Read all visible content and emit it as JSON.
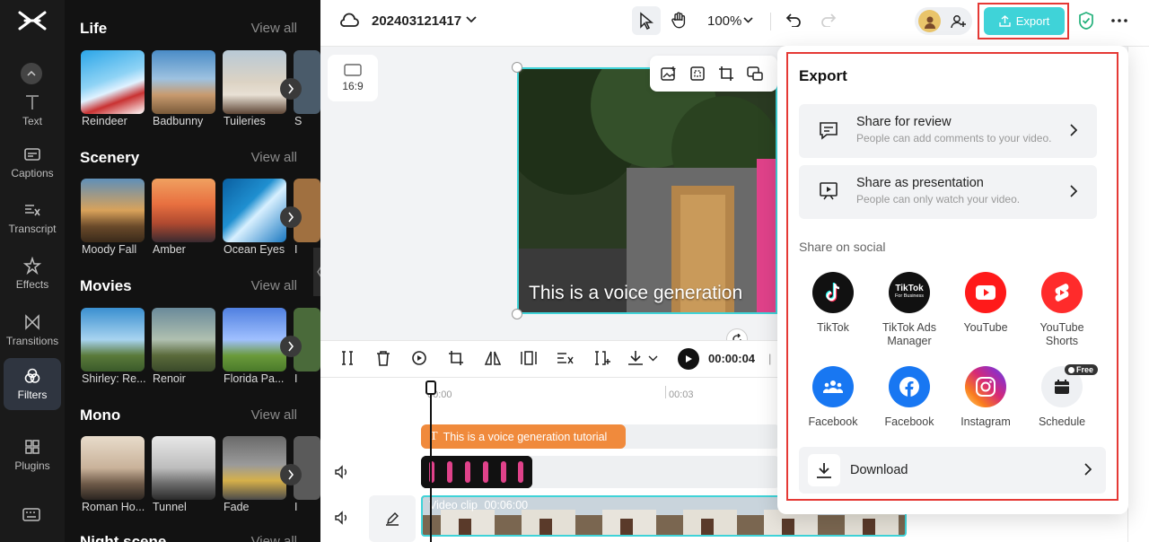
{
  "rail": {
    "items": [
      {
        "label": "Text",
        "icon": "text-icon"
      },
      {
        "label": "Captions",
        "icon": "captions-icon"
      },
      {
        "label": "Transcript",
        "icon": "transcript-icon"
      },
      {
        "label": "Effects",
        "icon": "effects-icon"
      },
      {
        "label": "Transitions",
        "icon": "transitions-icon"
      },
      {
        "label": "Filters",
        "icon": "filters-icon",
        "active": true
      },
      {
        "label": "Plugins",
        "icon": "plugins-icon"
      }
    ]
  },
  "filters": {
    "sections": [
      {
        "title": "Life",
        "view_all": "View all",
        "items": [
          "Reindeer",
          "Badbunny",
          "Tuileries",
          "S"
        ]
      },
      {
        "title": "Scenery",
        "view_all": "View all",
        "items": [
          "Moody Fall",
          "Amber",
          "Ocean Eyes",
          "I"
        ]
      },
      {
        "title": "Movies",
        "view_all": "View all",
        "items": [
          "Shirley: Re...",
          "Renoir",
          "Florida Pa...",
          "I"
        ]
      },
      {
        "title": "Mono",
        "view_all": "View all",
        "items": [
          "Roman Ho...",
          "Tunnel",
          "Fade",
          "I"
        ]
      },
      {
        "title": "Night scene",
        "view_all": "View all",
        "items": []
      }
    ]
  },
  "topbar": {
    "project_title": "202403121417",
    "zoom": "100%",
    "export_label": "Export"
  },
  "canvas": {
    "ratio_label": "16:9",
    "subtitle": "This is a voice generation"
  },
  "timeline": {
    "timecode": "00:00:04",
    "timecode_sep": "|",
    "ruler": [
      "00:00",
      "00:03"
    ],
    "text_clip": "This is a voice generation tutorial",
    "video_clip_label": "Video clip",
    "video_clip_duration": "00:06:00"
  },
  "export_popup": {
    "title": "Export",
    "share_review": {
      "title": "Share for review",
      "sub": "People can add comments to your video."
    },
    "share_presentation": {
      "title": "Share as presentation",
      "sub": "People can only watch your video."
    },
    "social_heading": "Share on social",
    "social": [
      {
        "label": "TikTok",
        "icon": "tiktok-icon",
        "color": "#111111"
      },
      {
        "label": "TikTok Ads Manager",
        "icon": "tiktok-business-icon",
        "color": "#111111"
      },
      {
        "label": "YouTube",
        "icon": "youtube-icon",
        "color": "#ff1a1a"
      },
      {
        "label": "YouTube Shorts",
        "icon": "youtube-shorts-icon",
        "color": "#ff2b2b"
      },
      {
        "label": "Facebook",
        "icon": "facebook-group-icon",
        "color": "#1877f2"
      },
      {
        "label": "Facebook",
        "icon": "facebook-icon",
        "color": "#1877f2"
      },
      {
        "label": "Instagram",
        "icon": "instagram-icon",
        "color": "#d6249f"
      },
      {
        "label": "Schedule",
        "icon": "schedule-icon",
        "color": "#eef0f3"
      }
    ],
    "tiktok_business_text": "TikTok",
    "tiktok_business_sub": "For Business",
    "free_badge": "Free",
    "download": "Download"
  },
  "colors": {
    "accent": "#3fd3d8",
    "highlight": "#e53935",
    "text_clip": "#f08a3c"
  }
}
